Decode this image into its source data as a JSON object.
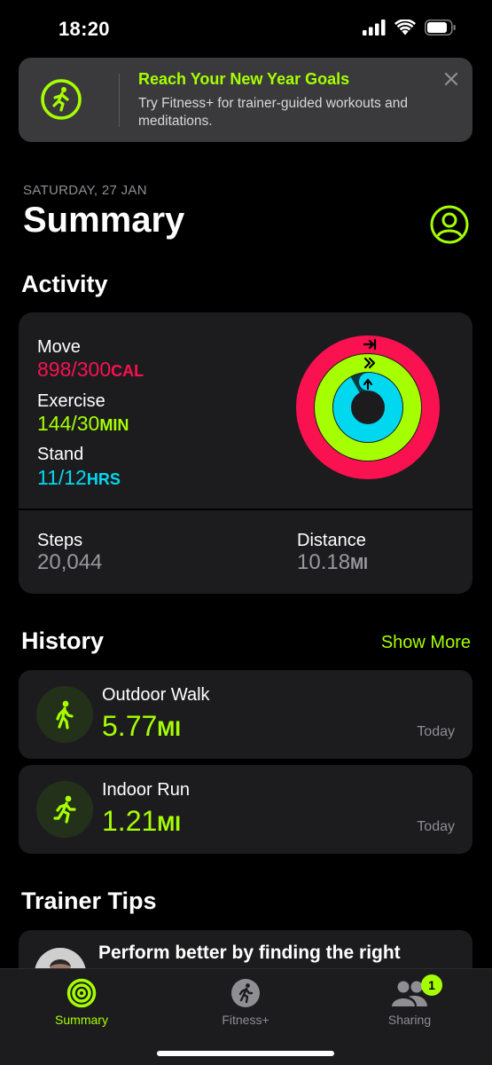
{
  "status_bar": {
    "time": "18:20"
  },
  "banner": {
    "title": "Reach Your New Year Goals",
    "text": "Try Fitness+ for trainer-guided workouts and meditations."
  },
  "header": {
    "date": "SATURDAY, 27 JAN",
    "title": "Summary"
  },
  "activity": {
    "section_title": "Activity",
    "move": {
      "label": "Move",
      "value": "898/300",
      "unit": "CAL",
      "color": "#fa114f"
    },
    "exercise": {
      "label": "Exercise",
      "value": "144/30",
      "unit": "MIN",
      "color": "#a6ff00"
    },
    "stand": {
      "label": "Stand",
      "value": "11/12",
      "unit": "HRS",
      "color": "#00d8f0"
    },
    "steps": {
      "label": "Steps",
      "value": "20,044"
    },
    "distance": {
      "label": "Distance",
      "value": "10.18",
      "unit": "MI"
    }
  },
  "history": {
    "section_title": "History",
    "show_more": "Show More",
    "items": [
      {
        "name": "Outdoor Walk",
        "value": "5.77",
        "unit": "MI",
        "date": "Today",
        "icon": "walk-icon"
      },
      {
        "name": "Indoor Run",
        "value": "1.21",
        "unit": "MI",
        "date": "Today",
        "icon": "run-icon"
      }
    ]
  },
  "trainer_tips": {
    "section_title": "Trainer Tips",
    "tip_title": "Perform better by finding the right"
  },
  "tab_bar": {
    "tabs": [
      {
        "label": "Summary",
        "icon": "summary-rings-icon",
        "active": true
      },
      {
        "label": "Fitness+",
        "icon": "fitness-plus-icon",
        "active": false
      },
      {
        "label": "Sharing",
        "icon": "sharing-icon",
        "active": false,
        "badge": "1"
      }
    ]
  },
  "colors": {
    "accent": "#a6ff00",
    "move": "#fa114f",
    "exercise": "#a6ff00",
    "stand": "#00d8f0",
    "card": "#1c1c1e"
  }
}
